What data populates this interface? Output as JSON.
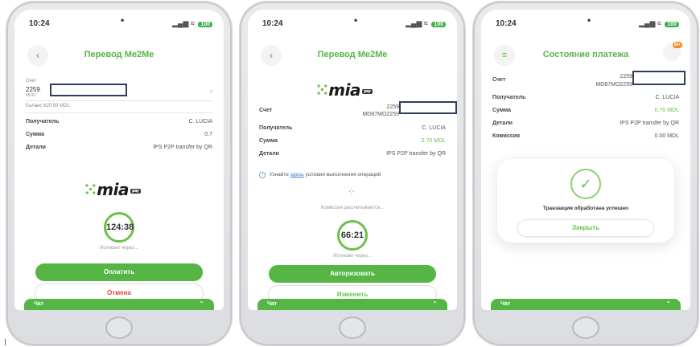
{
  "status": {
    "time": "10:24",
    "battery": "100"
  },
  "phone1": {
    "title": "Перевод Me2Me",
    "back_icon": "chevron-left-icon",
    "account_label": "Счет",
    "account_prefix": "2259",
    "account_sub": "MD87",
    "balance": "Баланс 620.93 MDL",
    "rows": [
      {
        "k": "Получатель",
        "v": "C. LUCIA"
      },
      {
        "k": "Сумма",
        "v": "0.7"
      },
      {
        "k": "Детали",
        "v": "IPS P2P transfer by QR"
      }
    ],
    "logo": "mia",
    "timer": "124:38",
    "timer_caption": "Истекает через...",
    "pay_button": "Оплатить",
    "cancel_button": "Отмена",
    "chat": "Чат"
  },
  "phone2": {
    "title": "Перевод Me2Me",
    "logo": "mia",
    "account_label": "Счет",
    "account_prefix": "2259",
    "account_sub": "MD87MO2259",
    "rows": [
      {
        "k": "Получатель",
        "v": "C. LUCIA"
      },
      {
        "k": "Сумма",
        "v": "0.70 MDL"
      },
      {
        "k": "Детали",
        "v": "IPS P2P transfer by QR"
      }
    ],
    "info_prefix": "Узнайте",
    "info_link": "здесь",
    "info_suffix": "условия выполнения операций",
    "calc_caption": "Комиссия рассчитывается...",
    "timer": "66:21",
    "timer_caption": "Истекает через...",
    "authorize_button": "Авторизовать",
    "change_button": "Изменить",
    "chat": "Чат"
  },
  "phone3": {
    "title": "Состояние платежа",
    "notif_count": "99+",
    "account_label": "Счет",
    "account_prefix": "2259",
    "account_sub": "MD87MO2259",
    "rows": [
      {
        "k": "Получатель",
        "v": "C. LUCIA"
      },
      {
        "k": "Сумма",
        "v": "0.70 MDL"
      },
      {
        "k": "Детали",
        "v": "IPS P2P transfer by QR"
      },
      {
        "k": "Комиссия",
        "v": "0.00 MDL"
      }
    ],
    "success_text": "Транзакция обработана успешно",
    "close_button": "Закрыть",
    "chat": "Чат"
  },
  "colors": {
    "brand_green": "#55b646",
    "cancel_red": "#e0453f"
  }
}
